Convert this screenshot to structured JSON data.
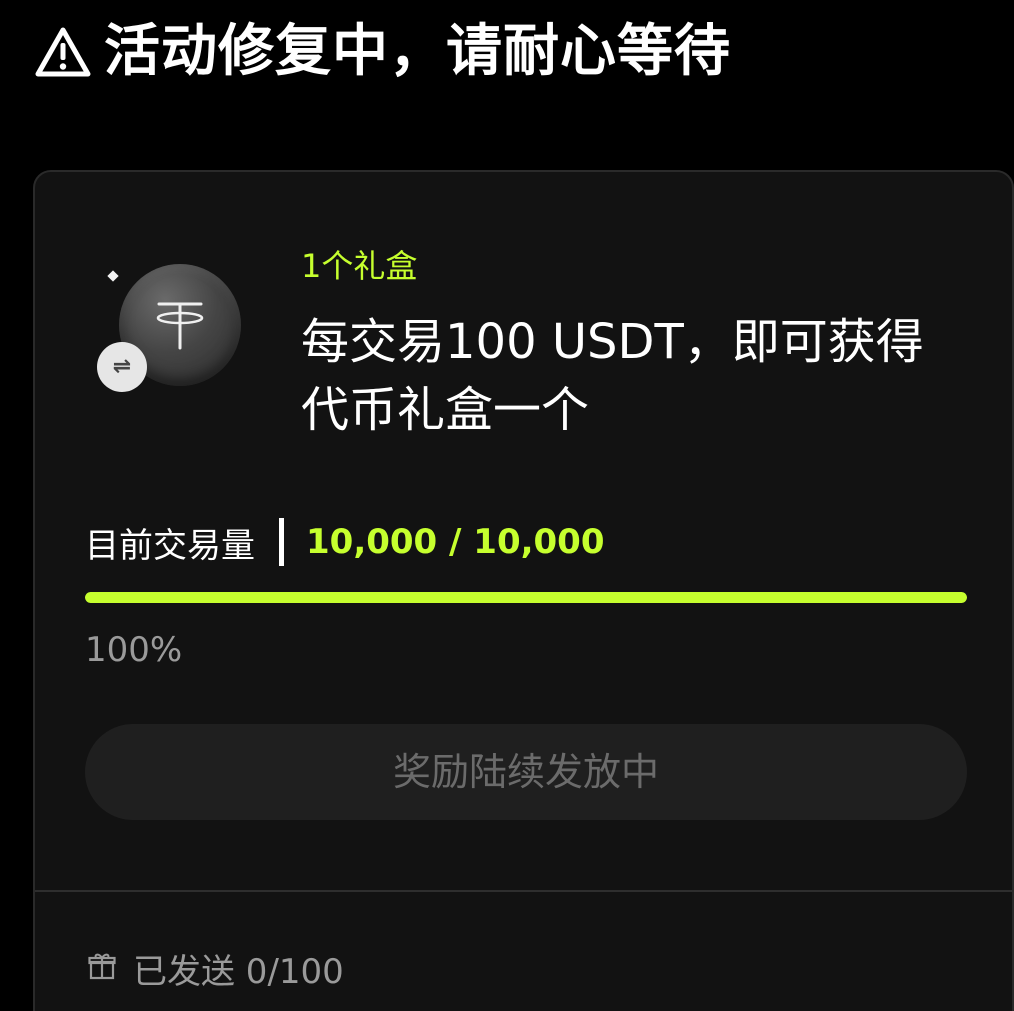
{
  "notice": {
    "icon": "warning-icon",
    "text": "活动修复中，请耐心等待"
  },
  "card": {
    "token": {
      "icon": "tether-coin-icon",
      "badge_icon": "swap-icon",
      "badge_symbol": "⇌"
    },
    "gift_count": "1个礼盒",
    "headline": "每交易100 USDT，即可获得代币礼盒一个",
    "volume": {
      "label": "目前交易量",
      "value": "10,000 / 10,000"
    },
    "progress": {
      "fraction": 1.0,
      "text": "100%"
    },
    "status_button": "奖励陆续发放中",
    "sent": {
      "icon": "gift-icon",
      "text": "已发送 0/100"
    }
  },
  "colors": {
    "accent": "#c6ff2e",
    "background": "#000000",
    "card": "#121212",
    "muted_text": "#9a9a9a"
  }
}
